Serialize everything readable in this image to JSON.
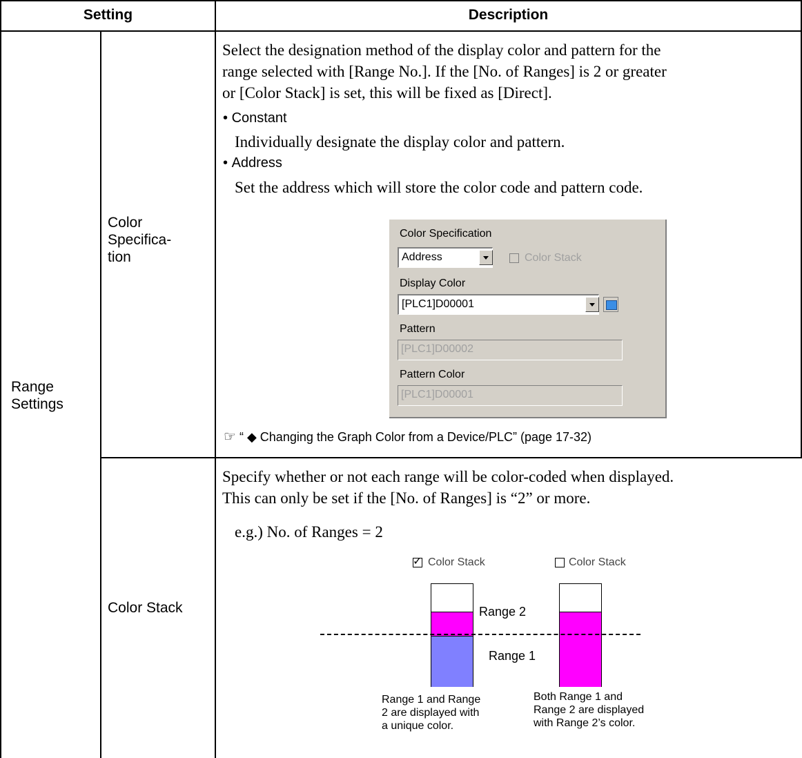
{
  "header": {
    "setting": "Setting",
    "description": "Description"
  },
  "group_label": [
    "Range",
    "Settings"
  ],
  "rows": [
    {
      "setting_lines": [
        "Color",
        "Specifica-",
        "tion"
      ],
      "desc_lines": [
        "Select the designation method of the display color and pattern for the",
        "range selected with [Range No.]. If the [No. of Ranges] is 2 or greater",
        "or [Color Stack] is set, this will be fixed as [Direct]."
      ],
      "options": [
        {
          "name": "Constant",
          "text": "Individually designate the display color and pattern."
        },
        {
          "name": "Address",
          "text": "Set the address which will store the color code and pattern code."
        }
      ],
      "reference": "“ ◆ Changing the Graph Color from a Device/PLC” (page 17-32)"
    },
    {
      "setting_lines": [
        "Color Stack"
      ],
      "desc_lines": [
        "Specify whether or not each range will be color-coded when displayed.",
        "This can only be set if the [No. of Ranges] is “2” or more."
      ],
      "example": "e.g.) No. of Ranges = 2"
    }
  ],
  "dialog": {
    "color_spec_label": "Color Specification",
    "color_spec_value": "Address",
    "color_stack_label": "Color Stack",
    "display_color_label": "Display Color",
    "display_color_value": "[PLC1]D00001",
    "pattern_label": "Pattern",
    "pattern_value": "[PLC1]D00002",
    "pattern_color_label": "Pattern Color",
    "pattern_color_value": "[PLC1]D00001"
  },
  "illustration": {
    "left_checkbox_label": "Color Stack",
    "right_checkbox_label": "Color Stack",
    "range2_label": "Range 2",
    "range1_label": "Range 1",
    "left_caption": [
      "Range 1 and Range",
      "2 are displayed with",
      "a unique color."
    ],
    "right_caption": [
      "Both Range 1 and",
      "Range 2 are displayed",
      "with Range 2’s color."
    ],
    "colors": {
      "range1": "#8080ff",
      "range2": "#ff00ff"
    }
  }
}
